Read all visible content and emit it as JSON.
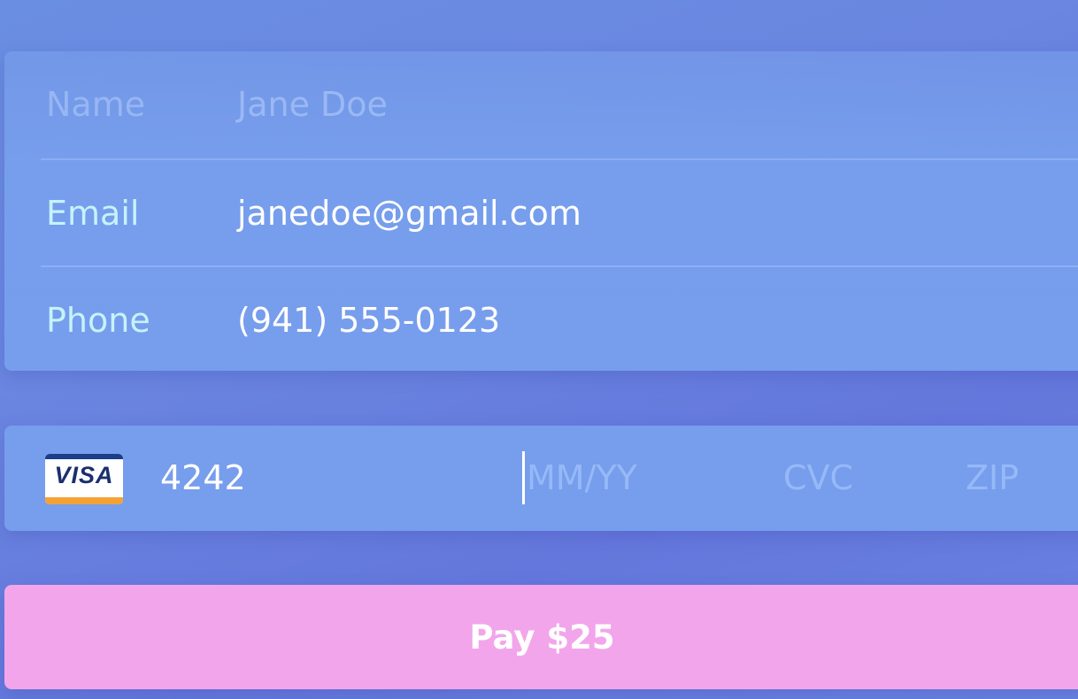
{
  "contact": {
    "name": {
      "label": "Name",
      "value": "Jane Doe"
    },
    "email": {
      "label": "Email",
      "value": "janedoe@gmail.com"
    },
    "phone": {
      "label": "Phone",
      "value": "(941) 555-0123"
    }
  },
  "card": {
    "brand": "VISA",
    "number": "4242",
    "expiry_placeholder": "MM/YY",
    "cvc_placeholder": "CVC",
    "zip_placeholder": "ZIP",
    "brand_colors": {
      "top": "#1a3e8a",
      "bottom": "#f4a236"
    }
  },
  "pay_button": {
    "label": "Pay $25",
    "color": "#f3a5eb"
  }
}
